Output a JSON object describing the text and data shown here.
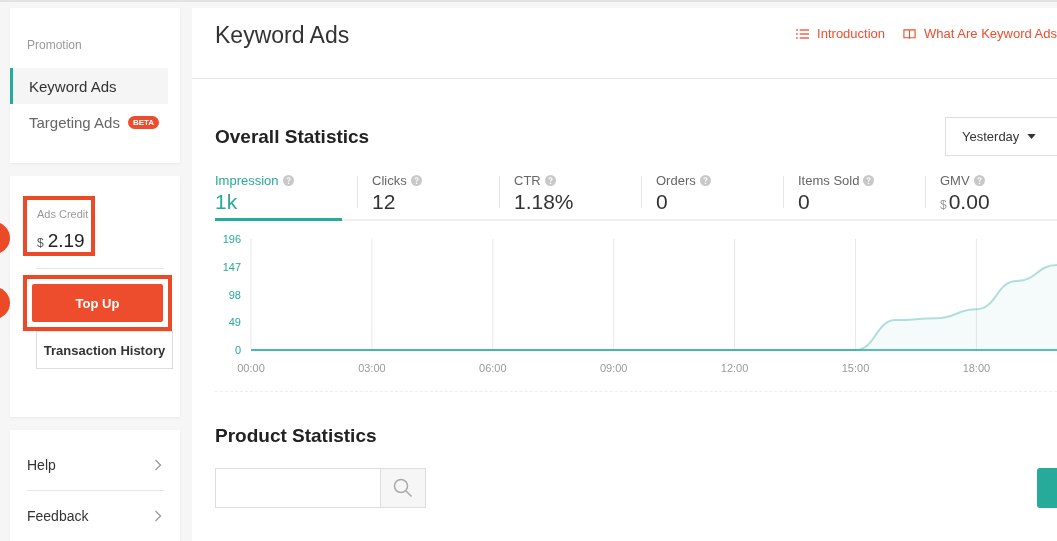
{
  "sidebar": {
    "section_title": "Promotion",
    "items": [
      {
        "label": "Keyword Ads",
        "selected": true
      },
      {
        "label": "Targeting Ads",
        "selected": false,
        "badge": "BETA"
      }
    ]
  },
  "credit": {
    "label": "Ads Credit",
    "currency": "$",
    "amount": "2.19",
    "highlighted": true
  },
  "top_up_button": {
    "label": "Top Up",
    "highlighted": true
  },
  "history_button": "Transaction History",
  "links": [
    {
      "label": "Help"
    },
    {
      "label": "Feedback"
    }
  ],
  "page_title": "Keyword Ads",
  "header_links": [
    {
      "kind": "list",
      "label": "Introduction"
    },
    {
      "kind": "book",
      "label": "What Are Keyword Ads"
    }
  ],
  "overall": {
    "title": "Overall Statistics",
    "period": "Yesterday",
    "metrics": [
      {
        "label": "Impression",
        "value": "1k",
        "selected": true
      },
      {
        "label": "Clicks",
        "value": "12",
        "selected": false
      },
      {
        "label": "CTR",
        "value": "1.18%",
        "selected": false
      },
      {
        "label": "Orders",
        "value": "0",
        "selected": false
      },
      {
        "label": "Items Sold",
        "value": "0",
        "selected": false
      },
      {
        "label": "GMV",
        "currency": "$",
        "value": "0.00",
        "selected": false
      }
    ],
    "chart_data": {
      "type": "area",
      "x": [
        0,
        1,
        2,
        3,
        4,
        5,
        6,
        7,
        8,
        9,
        10,
        11,
        12,
        13,
        14,
        15,
        16,
        17,
        18,
        19,
        20
      ],
      "series": [
        {
          "color": "#26aa99",
          "values": [
            0,
            0,
            0,
            0,
            0,
            0,
            0,
            0,
            0,
            0,
            0,
            0,
            0,
            0,
            0,
            0,
            53,
            56,
            72,
            122,
            150
          ]
        }
      ],
      "xlim": [
        0,
        20
      ],
      "grid": true,
      "ylim": [
        0,
        196
      ],
      "yticks": [
        0,
        49,
        98,
        147,
        196
      ],
      "xticks": [
        {
          "value": 0,
          "label": "00:00"
        },
        {
          "value": 3,
          "label": "03:00"
        },
        {
          "value": 6,
          "label": "06:00"
        },
        {
          "value": 9,
          "label": "09:00"
        },
        {
          "value": 12,
          "label": "12:00"
        },
        {
          "value": 15,
          "label": "15:00"
        },
        {
          "value": 18,
          "label": "18:00"
        }
      ]
    }
  },
  "product": {
    "title": "Product Statistics"
  }
}
